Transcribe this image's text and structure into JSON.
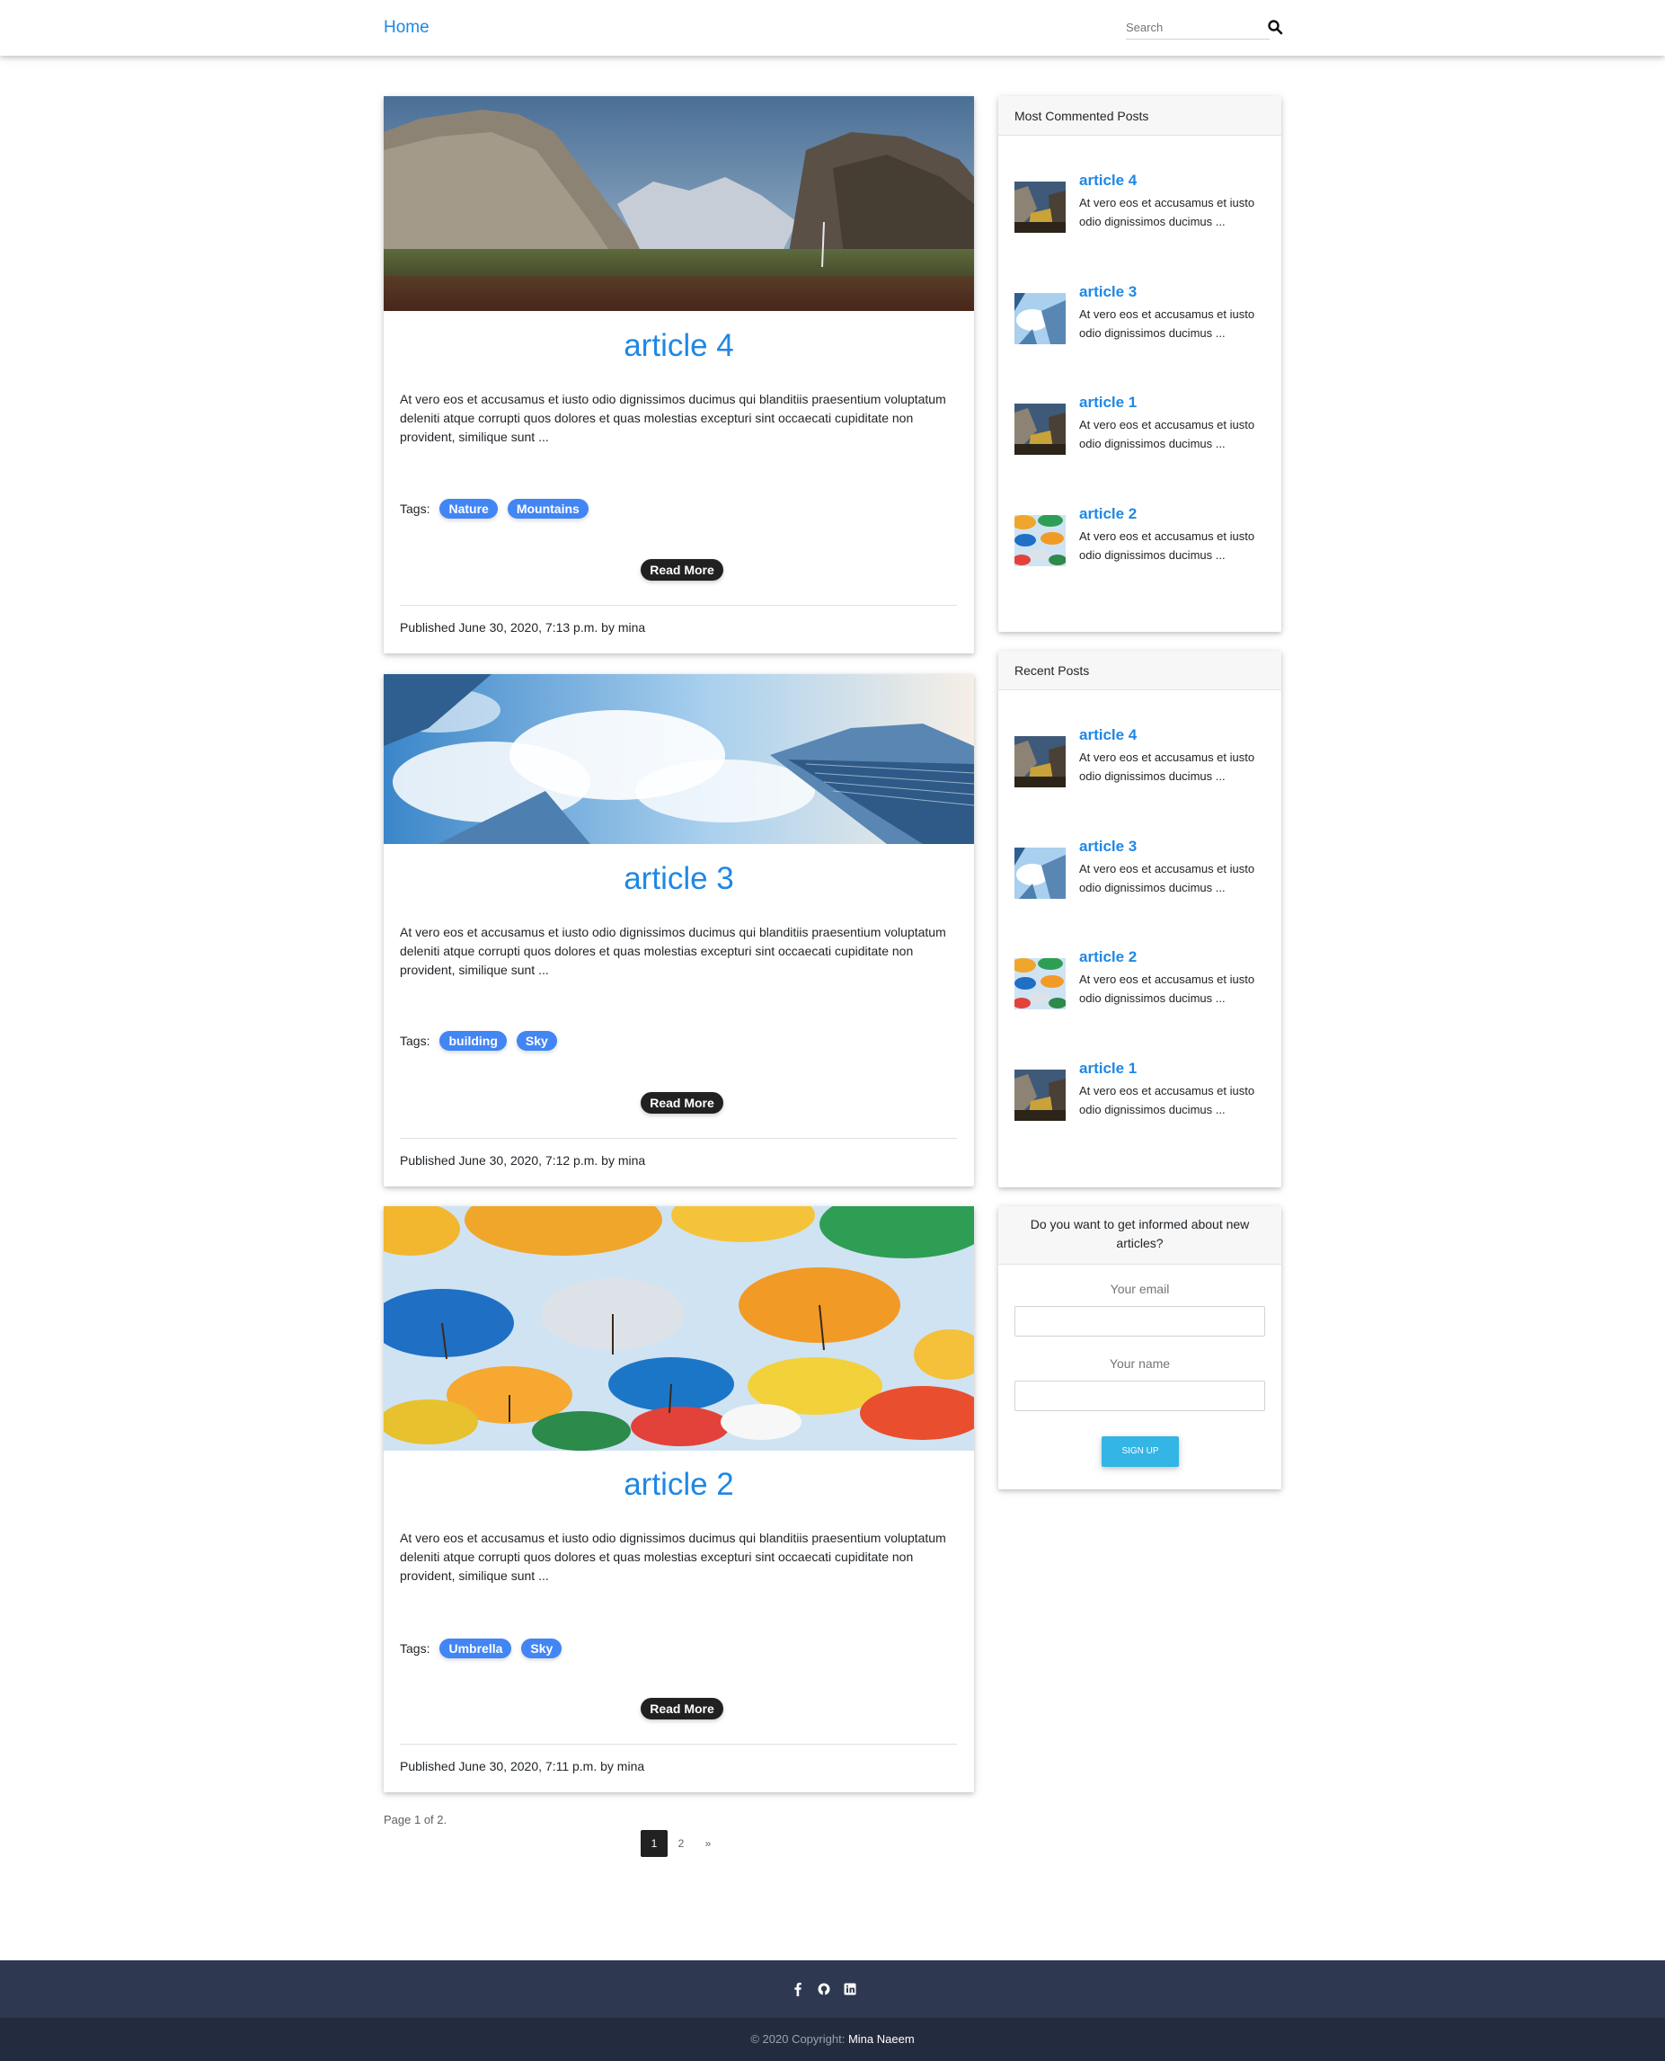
{
  "nav": {
    "home_label": "Home",
    "search_placeholder": "Search"
  },
  "articles": [
    {
      "title": "article 4",
      "excerpt": "At vero eos et accusamus et iusto odio dignissimos ducimus qui blanditiis praesentium voluptatum deleniti atque corrupti quos dolores et quas molestias excepturi sint occaecati cupiditate non provident, similique sunt ...",
      "tags_label": "Tags:",
      "tags": [
        "Nature",
        "Mountains"
      ],
      "read_more": "Read More",
      "published": "Published June 30, 2020, 7:13 p.m. by mina"
    },
    {
      "title": "article 3",
      "excerpt": "At vero eos et accusamus et iusto odio dignissimos ducimus qui blanditiis praesentium voluptatum deleniti atque corrupti quos dolores et quas molestias excepturi sint occaecati cupiditate non provident, similique sunt ...",
      "tags_label": "Tags:",
      "tags": [
        "building",
        "Sky"
      ],
      "read_more": "Read More",
      "published": "Published June 30, 2020, 7:12 p.m. by mina"
    },
    {
      "title": "article 2",
      "excerpt": "At vero eos et accusamus et iusto odio dignissimos ducimus qui blanditiis praesentium voluptatum deleniti atque corrupti quos dolores et quas molestias excepturi sint occaecati cupiditate non provident, similique sunt ...",
      "tags_label": "Tags:",
      "tags": [
        "Umbrella",
        "Sky"
      ],
      "read_more": "Read More",
      "published": "Published June 30, 2020, 7:11 p.m. by mina"
    }
  ],
  "most_commented": {
    "title": "Most Commented Posts",
    "items": [
      {
        "title": "article 4",
        "text": "At vero eos et accusamus et iusto odio dignissimos ducimus ..."
      },
      {
        "title": "article 3",
        "text": "At vero eos et accusamus et iusto odio dignissimos ducimus ..."
      },
      {
        "title": "article 1",
        "text": "At vero eos et accusamus et iusto odio dignissimos ducimus ..."
      },
      {
        "title": "article 2",
        "text": "At vero eos et accusamus et iusto odio dignissimos ducimus ..."
      }
    ]
  },
  "recent_posts": {
    "title": "Recent Posts",
    "items": [
      {
        "title": "article 4",
        "text": "At vero eos et accusamus et iusto odio dignissimos ducimus ..."
      },
      {
        "title": "article 3",
        "text": "At vero eos et accusamus et iusto odio dignissimos ducimus ..."
      },
      {
        "title": "article 2",
        "text": "At vero eos et accusamus et iusto odio dignissimos ducimus ..."
      },
      {
        "title": "article 1",
        "text": "At vero eos et accusamus et iusto odio dignissimos ducimus ..."
      }
    ]
  },
  "newsletter": {
    "title": "Do you want to get informed about new articles?",
    "email_label": "Your email",
    "name_label": "Your name",
    "email_value": "",
    "name_value": "",
    "button_label": "SIGN UP"
  },
  "pagination": {
    "info": "Page 1 of 2.",
    "pages": [
      "1",
      "2"
    ],
    "current": "1",
    "next_label": "»"
  },
  "footer": {
    "social_icons": [
      "facebook-icon",
      "github-icon",
      "linkedin-icon"
    ],
    "copyright_prefix": "© 2020 Copyright:",
    "copyright_owner": "Mina Naeem"
  },
  "colors": {
    "accent": "#1e88e5",
    "tag": "#4285f4",
    "button_dark": "#212121",
    "signup": "#33b5e5",
    "footer_top": "#2e3851",
    "footer_bottom": "#232b3e"
  }
}
